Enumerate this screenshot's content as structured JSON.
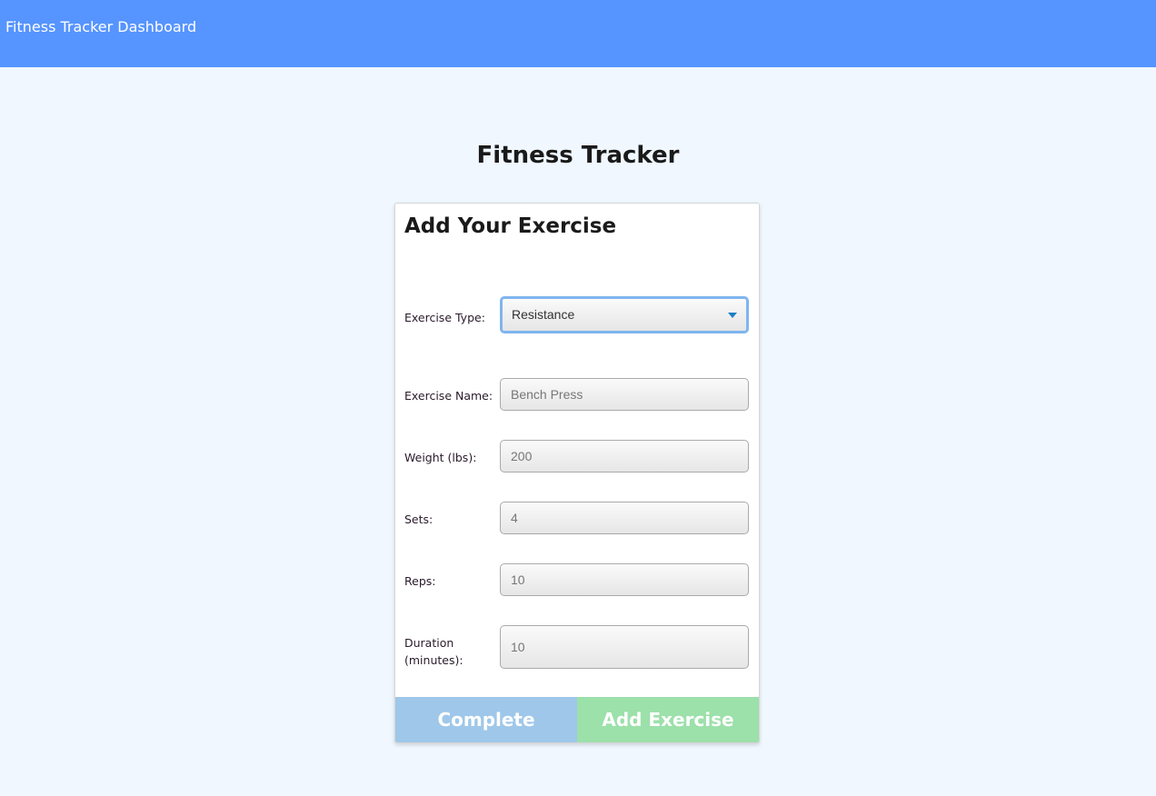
{
  "header": {
    "title": "Fitness Tracker Dashboard"
  },
  "page": {
    "title": "Fitness Tracker"
  },
  "form": {
    "title": "Add Your Exercise",
    "exercise_type": {
      "label": "Exercise Type:",
      "value": "Resistance"
    },
    "exercise_name": {
      "label": "Exercise Name:",
      "placeholder": "Bench Press"
    },
    "weight": {
      "label": "Weight (lbs):",
      "placeholder": "200"
    },
    "sets": {
      "label": "Sets:",
      "placeholder": "4"
    },
    "reps": {
      "label": "Reps:",
      "placeholder": "10"
    },
    "duration": {
      "label_line1": "Duration",
      "label_line2": "(minutes):",
      "placeholder": "10"
    },
    "complete_label": "Complete",
    "add_label": "Add Exercise"
  },
  "colors": {
    "header": "#5694ff",
    "complete": "#9fc7e9",
    "add": "#9ce0aa",
    "focus": "#7fb5ef"
  }
}
